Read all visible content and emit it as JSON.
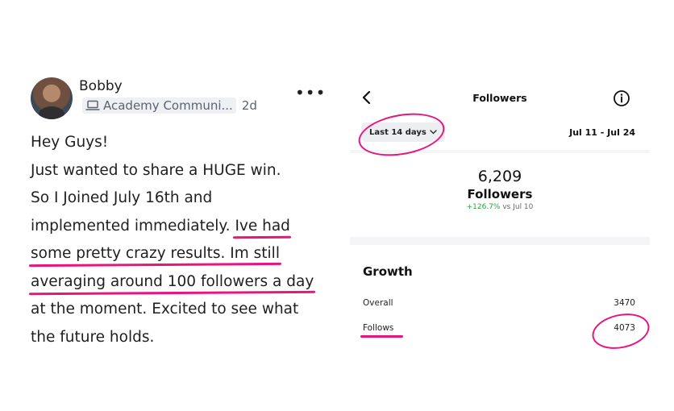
{
  "post": {
    "author": "Bobby",
    "community": "Academy Communi...",
    "time": "2d",
    "more_glyph": "•••",
    "lines": [
      {
        "text": "Hey Guys!",
        "hl": ""
      },
      {
        "text": "Just wanted to share a HUGE win.",
        "hl": ""
      },
      {
        "text": "So I Joined July 16th and",
        "hl": ""
      },
      {
        "text": "implemented immediately. ",
        "hl": "Ive had"
      },
      {
        "text": "",
        "hl": "some pretty crazy results. Im still"
      },
      {
        "text": "",
        "hl": "averaging around 100 followers a day"
      },
      {
        "text": "at the moment. Excited to see what",
        "hl": ""
      },
      {
        "text": "the future holds.",
        "hl": ""
      }
    ]
  },
  "insights": {
    "title": "Followers",
    "range_label": "Last 14 days",
    "date_range": "Jul 11 - Jul 24",
    "followers_count": "6,209",
    "followers_label": "Followers",
    "change_pct": "+126.7%",
    "change_vs": " vs Jul 10",
    "growth_title": "Growth",
    "overall_label": "Overall",
    "overall_value": "3470",
    "follows_label": "Follows",
    "follows_value": "4073"
  },
  "colors": {
    "highlight": "#e8157c",
    "positive": "#2f9e44"
  }
}
